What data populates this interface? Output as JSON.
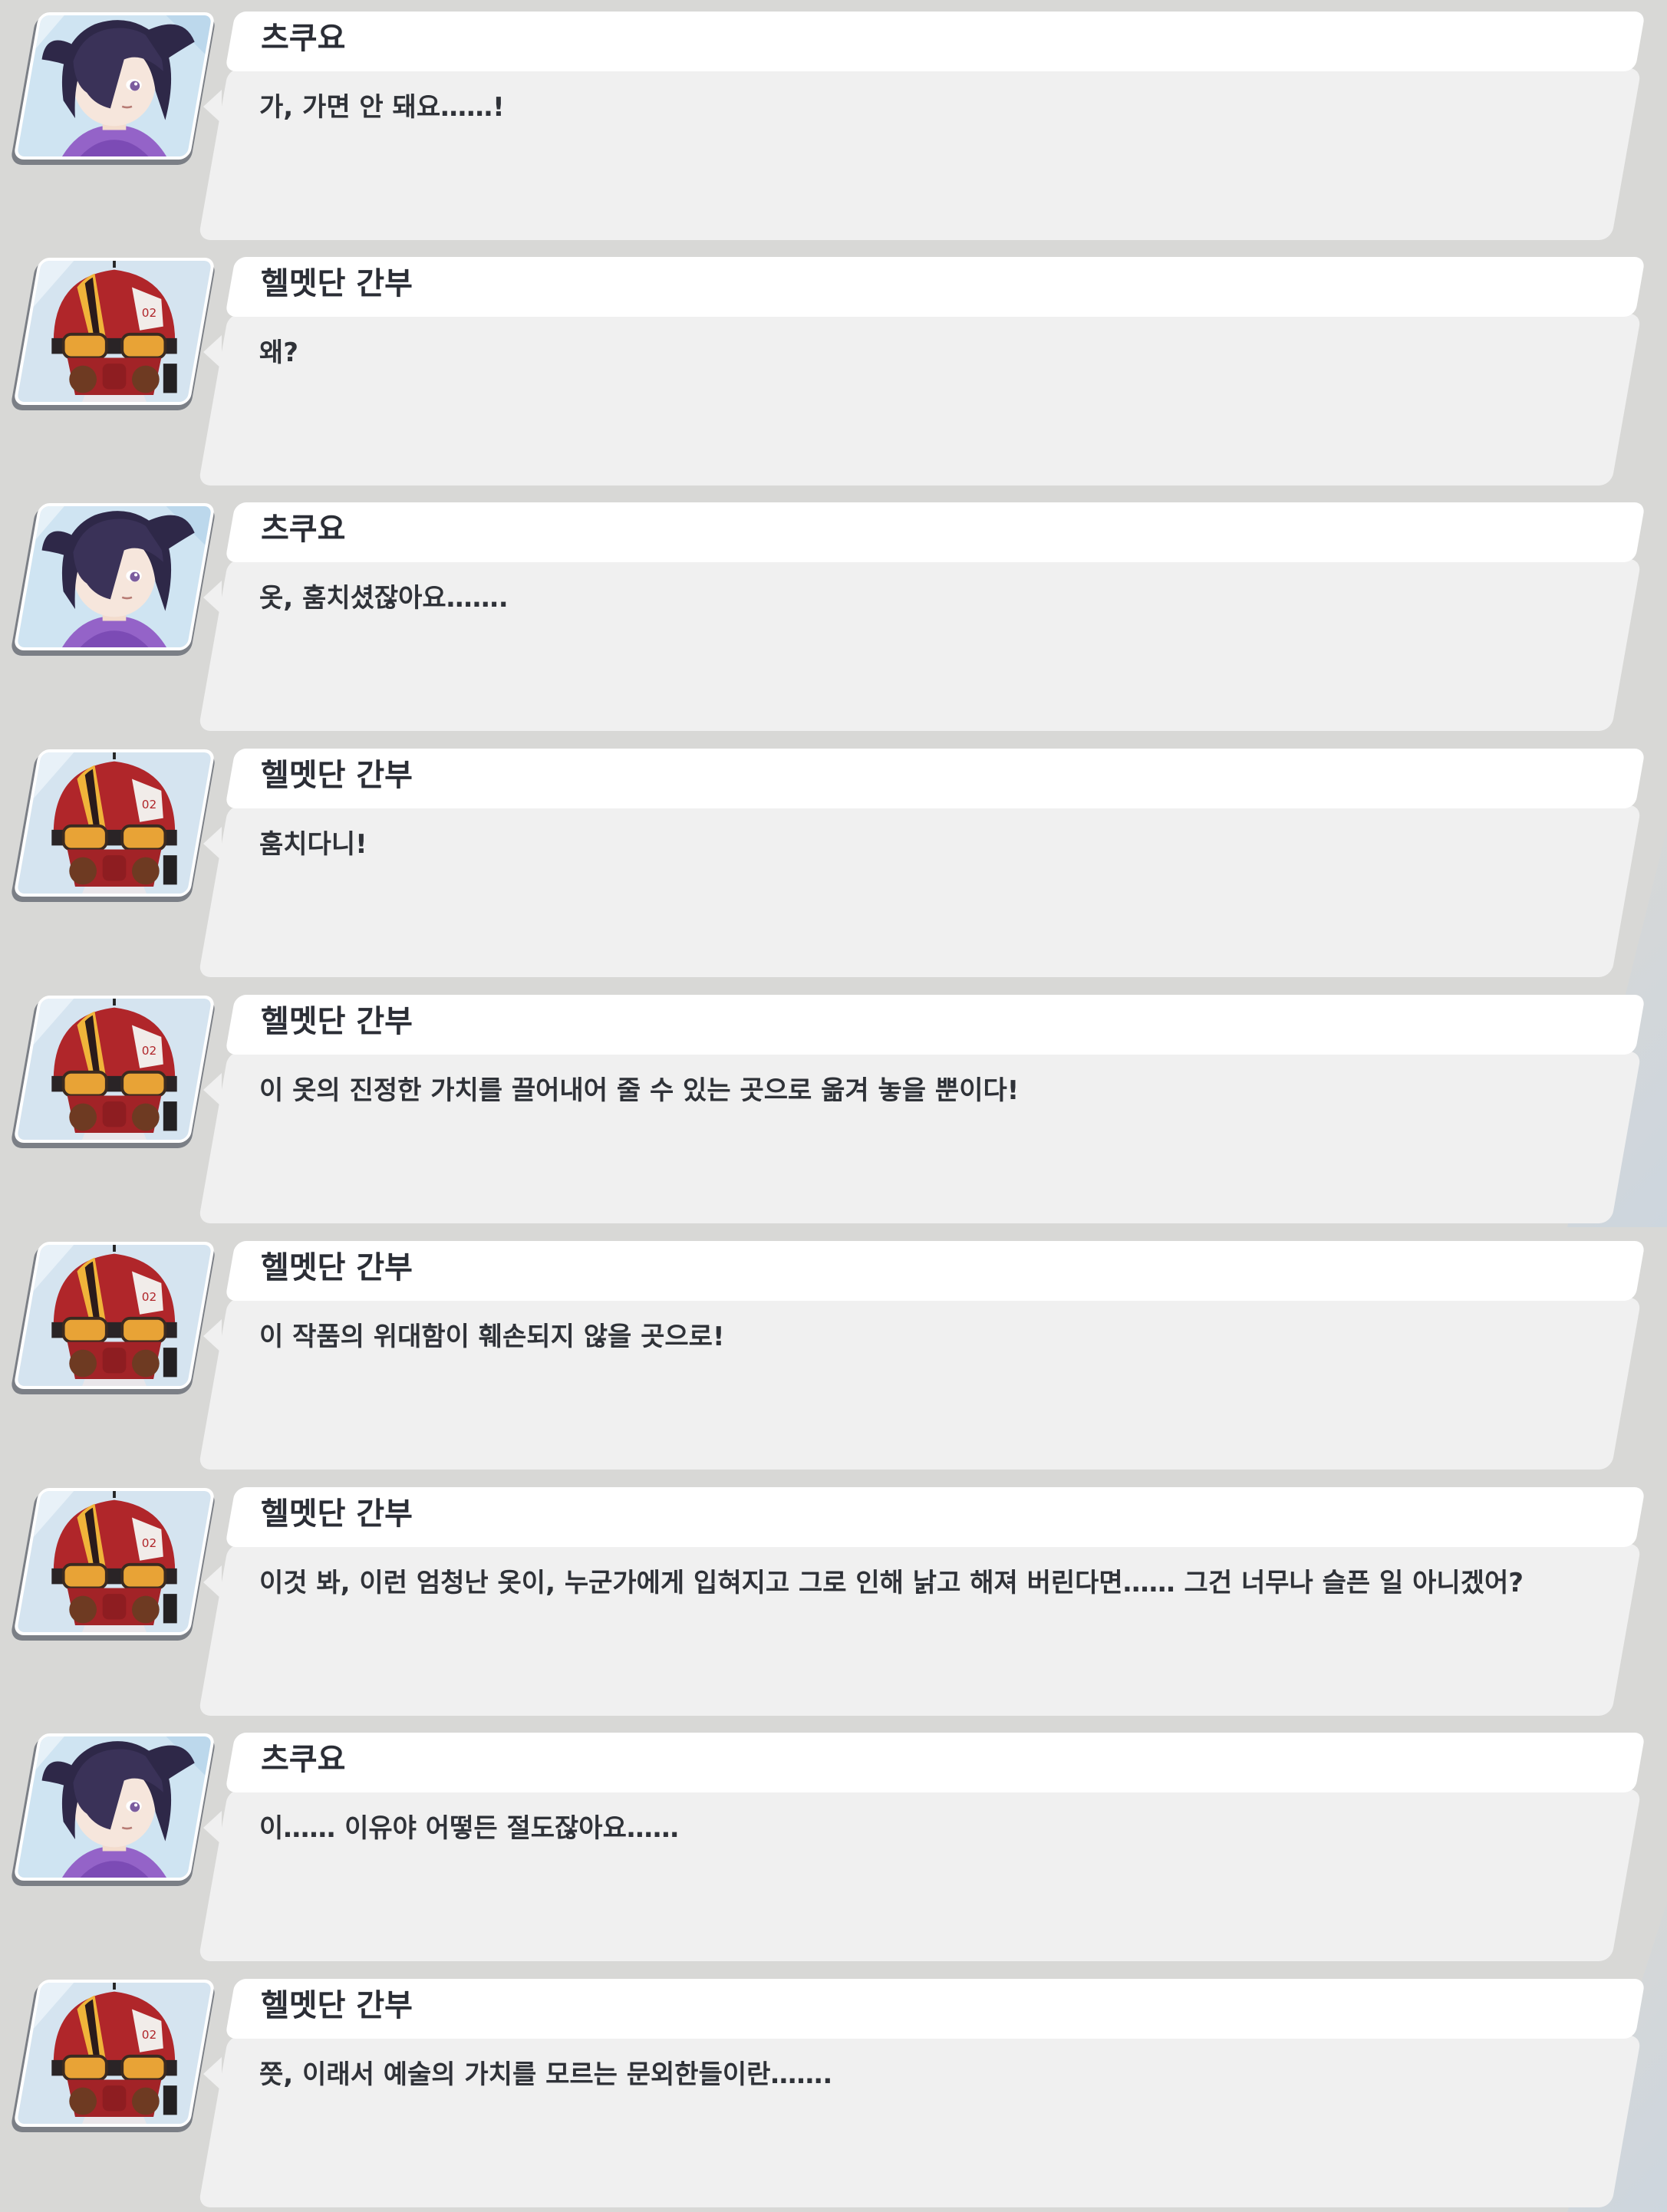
{
  "characters": {
    "tsukuyo": {
      "name": "츠쿠요",
      "avatar_icon": "tsukuyo-portrait-icon",
      "colors": {
        "hair": "#2e2848",
        "skin": "#f6e6dc",
        "scarf": "#9463c8",
        "bg": "#cfe4f2"
      }
    },
    "helmet": {
      "name": "헬멧단 간부",
      "avatar_icon": "helmet-gang-portrait-icon",
      "colors": {
        "helmet": "#b0262a",
        "stripe": "#f0b43a",
        "goggle": "#e8a336",
        "bg": "#d5e4f0"
      }
    }
  },
  "dialogues": [
    {
      "speaker": "츠쿠요",
      "type": "tsukuyo",
      "text": "가, 가면 안 돼요……!"
    },
    {
      "speaker": "헬멧단 간부",
      "type": "helmet",
      "text": "왜?"
    },
    {
      "speaker": "츠쿠요",
      "type": "tsukuyo",
      "text": "옷, 훔치셨잖아요……."
    },
    {
      "speaker": "헬멧단 간부",
      "type": "helmet",
      "text": "훔치다니!"
    },
    {
      "speaker": "헬멧단 간부",
      "type": "helmet",
      "text": "이 옷의 진정한 가치를 끌어내어 줄 수 있는 곳으로 옮겨 놓을 뿐이다!"
    },
    {
      "speaker": "헬멧단 간부",
      "type": "helmet",
      "text": "이 작품의 위대함이 훼손되지 않을 곳으로!"
    },
    {
      "speaker": "헬멧단 간부",
      "type": "helmet",
      "text": "이것 봐, 이런 엄청난 옷이, 누군가에게 입혀지고 그로 인해 낡고 해져 버린다면…… 그건 너무나 슬픈 일 아니겠어?"
    },
    {
      "speaker": "츠쿠요",
      "type": "tsukuyo",
      "text": "이…… 이유야 어떻든 절도잖아요……"
    },
    {
      "speaker": "헬멧단 간부",
      "type": "helmet",
      "text": "쯧, 이래서 예술의 가치를 모르는 문외한들이란……."
    }
  ],
  "theme": {
    "background": "#d8d8d6",
    "name_bar": "#ffffff",
    "text_box": "#f0f0f0",
    "name_color": "#2b2e36",
    "text_color": "#2f3238"
  }
}
